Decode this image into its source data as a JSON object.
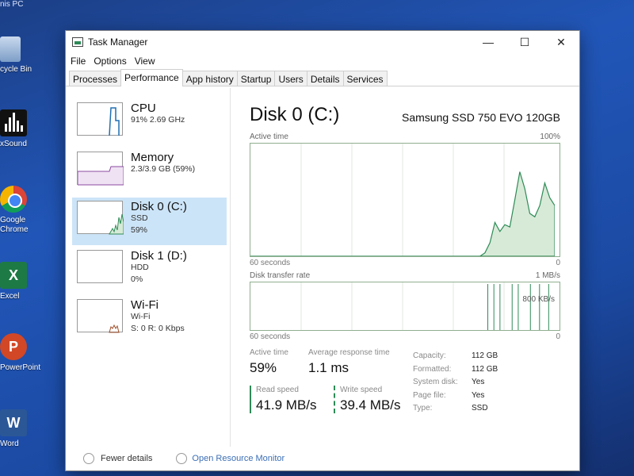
{
  "desktop": {
    "top_label": "nis PC",
    "icons": [
      {
        "label": "cycle Bin"
      },
      {
        "label": "xSound"
      },
      {
        "label": "Google Chrome",
        "line1": "Google",
        "line2": "Chrome"
      },
      {
        "label": "Excel",
        "glyph": "X"
      },
      {
        "label": "PowerPoint",
        "glyph": "P"
      },
      {
        "label": "Word",
        "glyph": "W"
      }
    ]
  },
  "window": {
    "title": "Task Manager",
    "controls": {
      "minimize": "—",
      "maximize": "☐",
      "close": "✕"
    }
  },
  "menu": [
    "File",
    "Options",
    "View"
  ],
  "tabs": [
    "Processes",
    "Performance",
    "App history",
    "Startup",
    "Users",
    "Details",
    "Services"
  ],
  "active_tab": "Performance",
  "resources": [
    {
      "name": "CPU",
      "sub1": "91%  2.69 GHz",
      "sub2": "",
      "icon": "cpu-graph"
    },
    {
      "name": "Memory",
      "sub1": "2.3/3.9 GB (59%)",
      "sub2": "",
      "icon": "memory-graph"
    },
    {
      "name": "Disk 0 (C:)",
      "sub1": "SSD",
      "sub2": "59%",
      "icon": "disk-graph",
      "selected": true
    },
    {
      "name": "Disk 1 (D:)",
      "sub1": "HDD",
      "sub2": "0%",
      "icon": "disk-graph"
    },
    {
      "name": "Wi-Fi",
      "sub1": "Wi-Fi",
      "sub2": "S: 0  R: 0 Kbps",
      "icon": "network-graph"
    }
  ],
  "detail": {
    "title": "Disk 0 (C:)",
    "model": "Samsung SSD 750 EVO 120GB",
    "active_time_chart": {
      "label": "Active time",
      "max_label": "100%",
      "left_axis": "60 seconds",
      "right_axis": "0",
      "values_pct": [
        0,
        0,
        0,
        0,
        0,
        0,
        0,
        0,
        0,
        0,
        0,
        0,
        0,
        0,
        0,
        0,
        0,
        0,
        0,
        0,
        0,
        0,
        0,
        0,
        0,
        0,
        0,
        0,
        0,
        0,
        0,
        0,
        0,
        0,
        0,
        0,
        0,
        0,
        0,
        0,
        0,
        0,
        0,
        0,
        0,
        0,
        0,
        3,
        12,
        30,
        22,
        28,
        26,
        50,
        75,
        60,
        38,
        35,
        45,
        65,
        52,
        45
      ]
    },
    "transfer_chart": {
      "label": "Disk transfer rate",
      "max_label": "1 MB/s",
      "mid_label": "800 KB/s",
      "left_axis": "60 seconds",
      "right_axis": "0"
    },
    "stats": {
      "active_time": {
        "label": "Active time",
        "value": "59%"
      },
      "avg_response": {
        "label": "Average response time",
        "value": "1.1 ms"
      },
      "read_speed": {
        "label": "Read speed",
        "value": "41.9 MB/s"
      },
      "write_speed": {
        "label": "Write speed",
        "value": "39.4 MB/s"
      }
    },
    "properties": [
      {
        "key": "Capacity:",
        "value": "112 GB"
      },
      {
        "key": "Formatted:",
        "value": "112 GB"
      },
      {
        "key": "System disk:",
        "value": "Yes"
      },
      {
        "key": "Page file:",
        "value": "Yes"
      },
      {
        "key": "Type:",
        "value": "SSD"
      }
    ]
  },
  "footer": {
    "fewer_details": "Fewer details",
    "open_monitor": "Open Resource Monitor"
  },
  "colors": {
    "graph_line": "#2e8b57",
    "graph_fill": "#d7ead7",
    "selected_bg": "#cce4f7",
    "cpu_line": "#1f6fb2"
  }
}
